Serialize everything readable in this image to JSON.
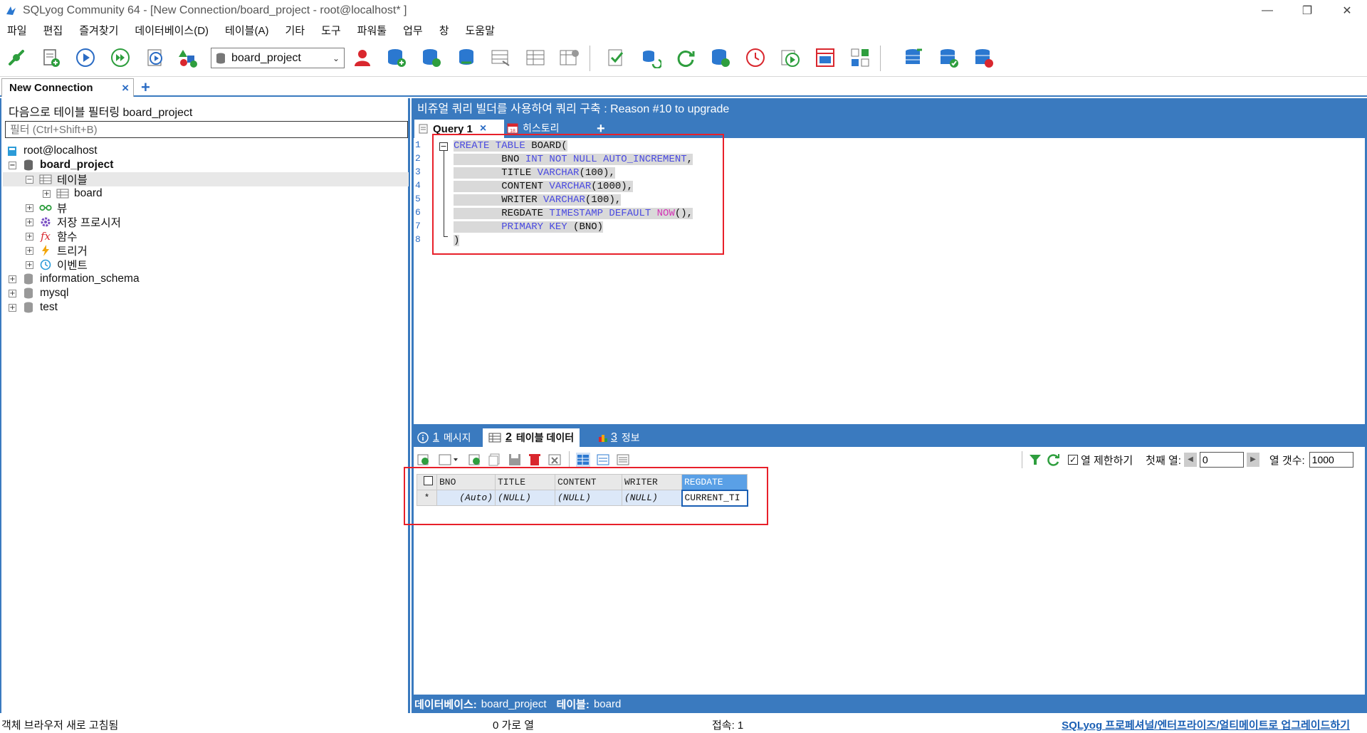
{
  "window": {
    "title": "SQLyog Community 64 - [New Connection/board_project - root@localhost* ]",
    "minimize": "—",
    "maximize": "❐",
    "close": "✕"
  },
  "menu": [
    "파일",
    "편집",
    "즐겨찾기",
    "데이터베이스(D)",
    "테이블(A)",
    "기타",
    "도구",
    "파워툴",
    "업무",
    "창",
    "도움말"
  ],
  "toolbar": {
    "database_select": "board_project"
  },
  "connection_tabs": {
    "active": "New Connection",
    "close": "×",
    "add": "+"
  },
  "object_browser": {
    "filter_label": "다음으로 테이블 필터링 board_project",
    "filter_placeholder": "필터 (Ctrl+Shift+B)",
    "tree": {
      "root": "root@localhost",
      "db_active": "board_project",
      "tables_folder": "테이블",
      "table_board": "board",
      "views": "뷰",
      "procedures": "저장 프로시저",
      "functions": "함수",
      "triggers": "트리거",
      "events": "이벤트",
      "db2": "information_schema",
      "db3": "mysql",
      "db4": "test"
    }
  },
  "query_builder_banner": "비쥬얼 쿼리 빌더를 사용하여 쿼리 구축 : Reason #10 to upgrade",
  "query_tabs": {
    "tab1": "Query 1",
    "tab1_close": "×",
    "tab2": "히스토리",
    "add": "+"
  },
  "editor": {
    "line_numbers": [
      "1",
      "2",
      "3",
      "4",
      "5",
      "6",
      "7",
      "8"
    ],
    "lines": [
      {
        "p1": "CREATE TABLE ",
        "p2": "BOARD("
      },
      {
        "p1": "        BNO ",
        "p2": "INT NOT NULL AUTO_INCREMENT",
        "p3": ","
      },
      {
        "p1": "        TITLE ",
        "p2": "VARCHAR",
        "p3": "(100),"
      },
      {
        "p1": "        CONTENT ",
        "p2": "VARCHAR",
        "p3": "(1000),"
      },
      {
        "p1": "        WRITER ",
        "p2": "VARCHAR",
        "p3": "(100),"
      },
      {
        "p1": "        REGDATE ",
        "p2": "TIMESTAMP DEFAULT ",
        "p3": "NOW",
        "p4": "(),"
      },
      {
        "p1": "        ",
        "p2": "PRIMARY KEY",
        "p3": " (BNO)"
      },
      {
        "p1": ")"
      }
    ]
  },
  "result_tabs": {
    "tab1_num": "1",
    "tab1": "메시지",
    "tab2_num": "2",
    "tab2": "테이블 데이터",
    "tab3_num": "3",
    "tab3": "정보"
  },
  "result_toolbar": {
    "limit_check": "✓",
    "limit_label": "열 제한하기",
    "first_row_label": "첫째 열:",
    "first_row_value": "0",
    "row_count_label": "열 갯수:",
    "row_count_value": "1000"
  },
  "grid": {
    "columns": [
      "BNO",
      "TITLE",
      "CONTENT",
      "WRITER",
      "REGDATE"
    ],
    "rows": [
      {
        "marker": "*",
        "cells": [
          "(Auto)",
          "(NULL)",
          "(NULL)",
          "(NULL)",
          "CURRENT_TI"
        ]
      }
    ]
  },
  "result_status": {
    "db_label": "데이터베이스:",
    "db_value": "board_project",
    "table_label": "테이블:",
    "table_value": "board"
  },
  "statusbar": {
    "left": "객체 브라우저 새로 고침됨",
    "rows": "0 가로 열",
    "connections": "접속: 1",
    "upgrade_link": "SQLyog 프로페셔널/엔터프라이즈/얼티메이트로 업그레이드하기"
  },
  "colors": {
    "accent": "#3a7abf",
    "highlight_box": "#e8202a",
    "keyword": "#4a4ae0",
    "function": "#d433b5"
  }
}
